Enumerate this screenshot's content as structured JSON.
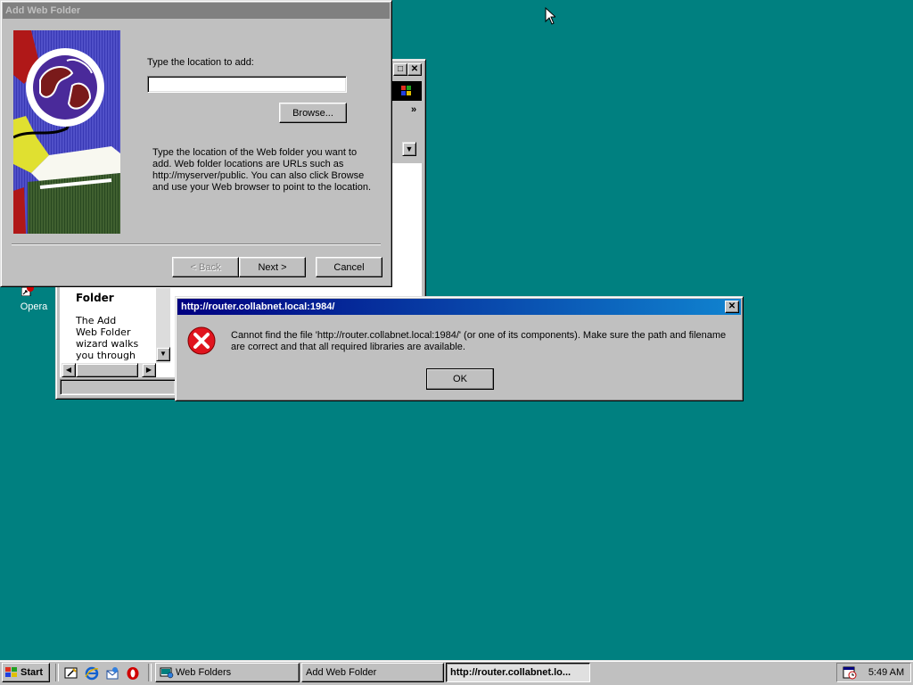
{
  "desktop": {
    "icons": [
      {
        "label": "Opera"
      }
    ]
  },
  "web_folders_window": {
    "sidebar_heading": "Folder",
    "sidebar_text_lines": [
      "The Add",
      "Web Folder",
      "wizard walks",
      "you through"
    ]
  },
  "add_web_folder_dialog": {
    "title": "Add Web Folder",
    "prompt_label": "Type the location to add:",
    "location_value": "",
    "browse_label": "Browse...",
    "description": "Type the location of the Web folder you want to add.  Web folder locations are URLs such as http://myserver/public.  You can also click Browse and use your Web browser to point to the location.",
    "back_label": "< Back",
    "next_label": "Next >",
    "cancel_label": "Cancel"
  },
  "error_dialog": {
    "title": "http://router.collabnet.local:1984/",
    "message": "Cannot find the file 'http://router.collabnet.local:1984/' (or one of its components). Make sure the path and filename are correct and that all required libraries are available.",
    "ok_label": "OK",
    "icon": "error-x-icon"
  },
  "taskbar": {
    "start_label": "Start",
    "quick_launch": [
      "show-desktop-icon",
      "internet-explorer-icon",
      "outlook-express-icon",
      "opera-icon"
    ],
    "tasks": [
      {
        "label": "Web Folders",
        "active": false
      },
      {
        "label": "Add Web Folder",
        "active": false
      },
      {
        "label": "http://router.collabnet.lo...",
        "active": true
      }
    ],
    "clock": "5:49 AM"
  },
  "colors": {
    "desktop": "#008080",
    "title_active_start": "#000080",
    "title_active_end": "#1084d0",
    "title_inactive": "#808080",
    "error_red": "#e0141e"
  }
}
